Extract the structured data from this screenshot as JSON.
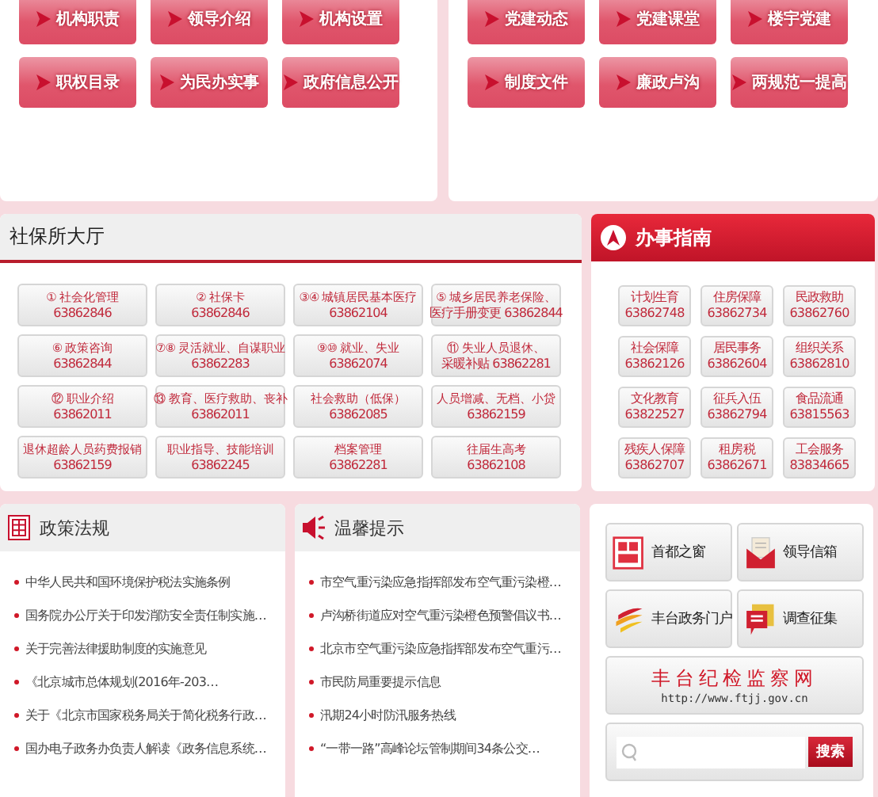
{
  "top_panels": [
    {
      "buttons": [
        "机构职责",
        "领导介绍",
        "机构设置",
        "职权目录",
        "为民办实事",
        "政府信息公开"
      ]
    },
    {
      "buttons": [
        "党建动态",
        "党建课堂",
        "楼宇党建",
        "制度文件",
        "廉政卢沟",
        "两规范一提高"
      ]
    }
  ],
  "social_hall": {
    "title": "社保所大厅",
    "items": [
      {
        "num": "①",
        "label": "社会化管理",
        "phone": "63862846"
      },
      {
        "num": "②",
        "label": "社保卡",
        "phone": "63862846"
      },
      {
        "num": "③④",
        "label": "城镇居民基本医疗",
        "phone": "63862104"
      },
      {
        "num": "⑤",
        "label": "城乡居民养老保险、",
        "phone": "医疗手册变更 63862844"
      },
      {
        "num": "⑥",
        "label": "政策咨询",
        "phone": "63862844"
      },
      {
        "num": "⑦⑧",
        "label": "灵活就业、自谋职业",
        "phone": "63862283"
      },
      {
        "num": "⑨⑩",
        "label": "就业、失业",
        "phone": "63862074"
      },
      {
        "num": "⑪",
        "label": "失业人员退休、",
        "phone": "采暖补贴 63862281"
      },
      {
        "num": "⑫",
        "label": "职业介绍",
        "phone": "63862011"
      },
      {
        "num": "⑬",
        "label": "教育、医疗救助、丧补",
        "phone": "63862011"
      },
      {
        "label": "社会救助（低保）",
        "phone": "63862085"
      },
      {
        "label": "人员增减、无档、小贷",
        "phone": "63862159"
      },
      {
        "label": "退休超龄人员药费报销",
        "phone": "63862159"
      },
      {
        "label": "职业指导、技能培训",
        "phone": "63862245"
      },
      {
        "label": "档案管理",
        "phone": "63862281"
      },
      {
        "label": "往届生高考",
        "phone": "63862108"
      }
    ]
  },
  "guide": {
    "title": "办事指南",
    "items": [
      {
        "label": "计划生育",
        "phone": "63862748"
      },
      {
        "label": "住房保障",
        "phone": "63862734"
      },
      {
        "label": "民政救助",
        "phone": "63862760"
      },
      {
        "label": "社会保障",
        "phone": "63862126"
      },
      {
        "label": "居民事务",
        "phone": "63862604"
      },
      {
        "label": "组织关系",
        "phone": "63862810"
      },
      {
        "label": "文化教育",
        "phone": "63822527"
      },
      {
        "label": "征兵入伍",
        "phone": "63862794"
      },
      {
        "label": "食品流通",
        "phone": "63815563"
      },
      {
        "label": "残疾人保障",
        "phone": "63862707"
      },
      {
        "label": "租房税",
        "phone": "63862671"
      },
      {
        "label": "工会服务",
        "phone": "83834665"
      }
    ]
  },
  "policy": {
    "title": "政策法规",
    "items": [
      "中华人民共和国环境保护税法实施条例",
      "国务院办公厅关于印发消防安全责任制实施…",
      "关于完善法律援助制度的实施意见",
      "《北京城市总体规划(2016年-203…",
      "关于《北京市国家税务局关于简化税务行政…",
      "国办电子政务办负责人解读《政务信息系统…"
    ]
  },
  "notices": {
    "title": "温馨提示",
    "items": [
      "市空气重污染应急指挥部发布空气重污染橙…",
      "卢沟桥街道应对空气重污染橙色预警倡议书…",
      "北京市空气重污染应急指挥部发布空气重污…",
      "市民防局重要提示信息",
      "汛期24小时防汛服务热线",
      "“一带一路”高峰论坛管制期间34条公交…"
    ]
  },
  "links": [
    {
      "kind": "window",
      "label": "首都之窗"
    },
    {
      "kind": "mail",
      "label": "领导信箱"
    },
    {
      "kind": "portal",
      "label": "丰台政务门户"
    },
    {
      "kind": "survey",
      "label": "调查征集"
    }
  ],
  "banner": {
    "title": "丰台纪检监察网",
    "url": "http://www.ftjj.gov.cn"
  },
  "search": {
    "button": "搜索"
  }
}
